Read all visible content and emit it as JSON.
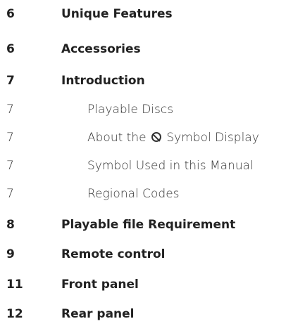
{
  "toc": {
    "entries": [
      {
        "page": "6",
        "title": "Unique Features"
      },
      {
        "page": "6",
        "title": "Accessories"
      },
      {
        "page": "7",
        "title": "Introduction"
      },
      {
        "page": "7",
        "title": "Playable Discs"
      },
      {
        "page": "7",
        "title_before": "About the",
        "icon": "prohibited-symbol-icon",
        "title_after": "Symbol Display"
      },
      {
        "page": "7",
        "title": "Symbol Used in this Manual"
      },
      {
        "page": "7",
        "title": "Regional Codes"
      },
      {
        "page": "8",
        "title": "Playable file Requirement"
      },
      {
        "page": "9",
        "title": "Remote control"
      },
      {
        "page": "11",
        "title": "Front panel"
      },
      {
        "page": "12",
        "title": "Rear panel"
      }
    ]
  }
}
